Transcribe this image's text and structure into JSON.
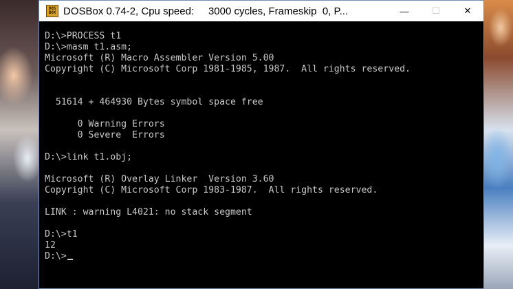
{
  "window": {
    "title": "DOSBox 0.74-2, Cpu speed:     3000 cycles, Frameskip  0, P...",
    "icon_text_top": "DOS",
    "icon_text_bottom": "BOX",
    "minimize_symbol": "—",
    "maximize_symbol": "☐",
    "close_symbol": "✕"
  },
  "console": {
    "lines": [
      "D:\\>PROCESS t1",
      "D:\\>masm t1.asm;",
      "Microsoft (R) Macro Assembler Version 5.00",
      "Copyright (C) Microsoft Corp 1981-1985, 1987.  All rights reserved.",
      "",
      "",
      "  51614 + 464930 Bytes symbol space free",
      "",
      "      0 Warning Errors",
      "      0 Severe  Errors",
      "",
      "D:\\>link t1.obj;",
      "",
      "Microsoft (R) Overlay Linker  Version 3.60",
      "Copyright (C) Microsoft Corp 1983-1987.  All rights reserved.",
      "",
      "LINK : warning L4021: no stack segment",
      "",
      "D:\\>t1",
      "12",
      "D:\\>"
    ]
  }
}
